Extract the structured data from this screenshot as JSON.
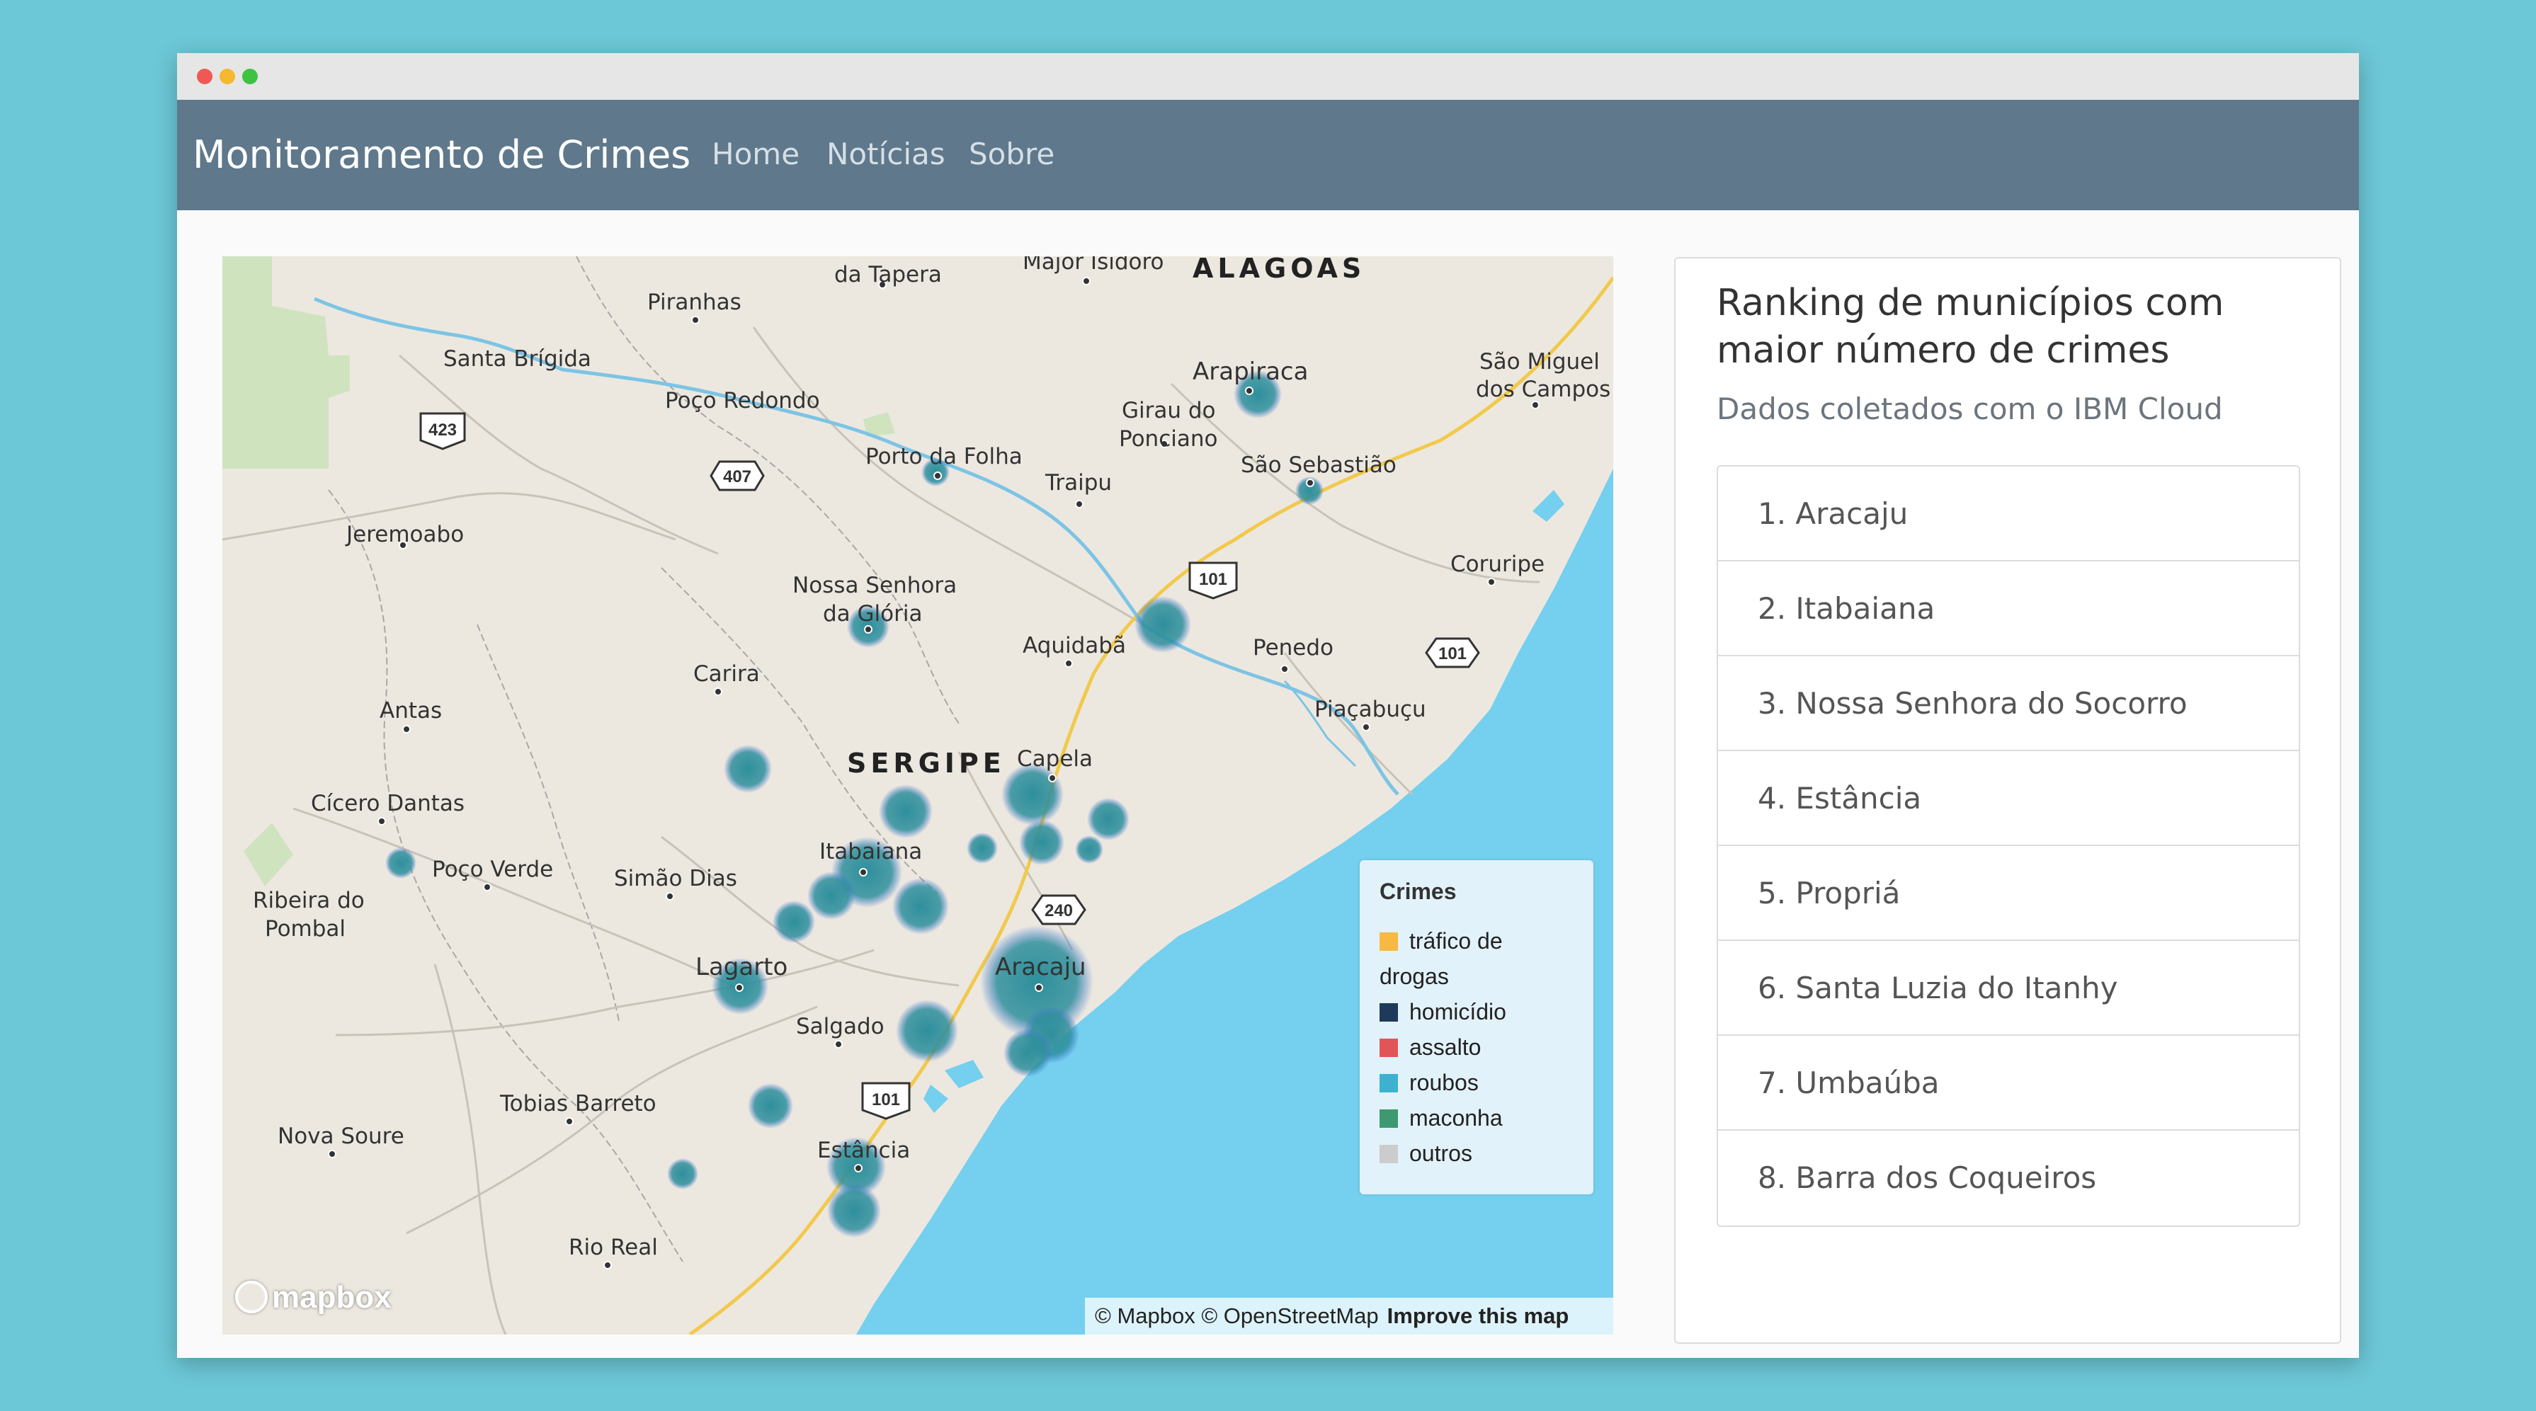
{
  "window": {
    "dot_colors": [
      "#ee5a52",
      "#f5b82e",
      "#3dc341"
    ]
  },
  "navbar": {
    "brand": "Monitoramento de Crimes",
    "links": [
      "Home",
      "Notícias",
      "Sobre"
    ]
  },
  "map": {
    "region_labels": [
      "ALAGOAS",
      "SERGIPE"
    ],
    "places": {
      "lagarto": "Lagarto",
      "aracaju": "Aracaju",
      "arapiraca": "Arapiraca",
      "itabaiana": "Itabaiana",
      "estancia": "Estância",
      "piranhas": "Piranhas",
      "da_tapera": "da Tapera",
      "major_isidoro": "Major Isidoro",
      "santa_brigida": "Santa Brígida",
      "poco_redondo": "Poço Redondo",
      "porto_da_folha": "Porto da Folha",
      "girau_1": "Girau do",
      "girau_2": "Ponciano",
      "traipu": "Traipu",
      "sao_sebastiao": "São Sebastião",
      "sao_miguel_1": "São Miguel",
      "sao_miguel_2": "dos Campos",
      "jeremoabo": "Jeremoabo",
      "nossa_gloria_1": "Nossa Senhora",
      "nossa_gloria_2": "da Glória",
      "coruripe": "Coruripe",
      "aquidaba": "Aquidabã",
      "penedo": "Penedo",
      "carira": "Carira",
      "piacabucu": "Piaçabuçu",
      "antas": "Antas",
      "capela": "Capela",
      "cicero_dantas": "Cícero Dantas",
      "poco_verde": "Poço Verde",
      "simao_dias": "Simão Dias",
      "ribeira_1": "Ribeira do",
      "ribeira_2": "Pombal",
      "salgado": "Salgado",
      "tobias_barreto": "Tobias Barreto",
      "nova_soure": "Nova Soure",
      "rio_real": "Rio Real"
    },
    "road_shields": {
      "s423": "423",
      "s407": "407",
      "s101a": "101",
      "s101b": "101",
      "s240": "240",
      "s101c": "101"
    },
    "cluster_color": "#2e8f9c",
    "legend": {
      "title": "Crimes",
      "items": [
        {
          "label": "tráfico de",
          "label2": "drogas",
          "color": "#f7b941"
        },
        {
          "label": "homicídio",
          "color": "#1d3a5a"
        },
        {
          "label": "assalto",
          "color": "#e15559"
        },
        {
          "label": "roubos",
          "color": "#3bb2d0"
        },
        {
          "label": "maconha",
          "color": "#3d9970"
        },
        {
          "label": "outros",
          "color": "#cccccc"
        }
      ]
    },
    "attribution": "© Mapbox © OpenStreetMap",
    "improve": "Improve this map",
    "logo": "mapbox"
  },
  "ranking": {
    "title": "Ranking de municípios com maior número de crimes",
    "subtitle": "Dados coletados com o IBM Cloud",
    "items": [
      "1. Aracaju",
      "2. Itabaiana",
      "3. Nossa Senhora do Socorro",
      "4. Estância",
      "5. Propriá",
      "6. Santa Luzia do Itanhy",
      "7. Umbaúba",
      "8. Barra dos Coqueiros"
    ]
  }
}
